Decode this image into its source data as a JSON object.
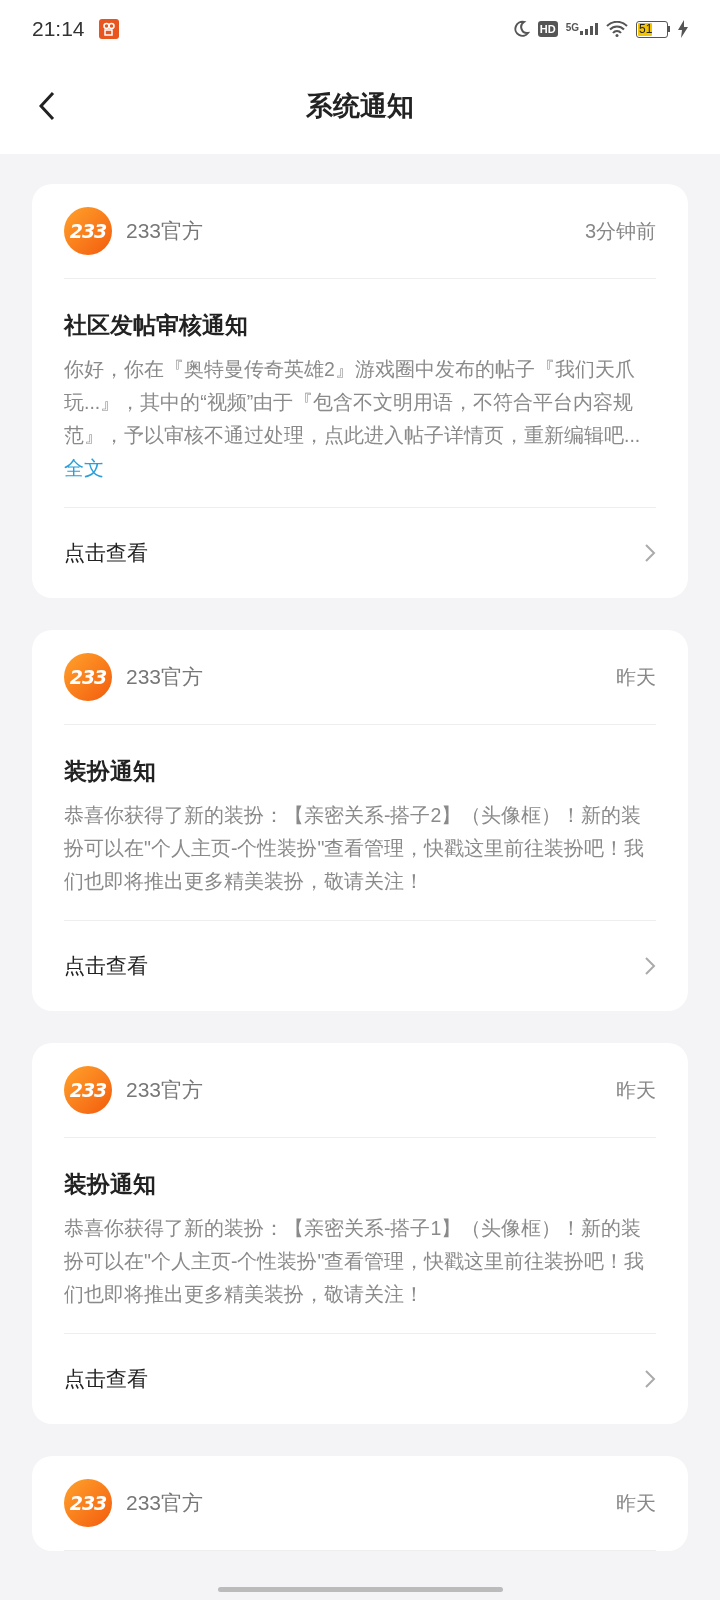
{
  "status_bar": {
    "time": "21:14",
    "network": "5G",
    "hd": "HD",
    "battery": "51"
  },
  "header": {
    "title": "系统通知"
  },
  "notifications": [
    {
      "logo_text": "233",
      "sender": "233官方",
      "time": "3分钟前",
      "title": "社区发帖审核通知",
      "body": "你好，你在『奥特曼传奇英雄2』游戏圈中发布的帖子『我们天爪玩...』，其中的“视频”由于『包含不文明用语，不符合平台内容规范』，予以审核不通过处理，点此进入帖子详情页，重新编辑吧...",
      "more_link": "全文",
      "action": "点击查看"
    },
    {
      "logo_text": "233",
      "sender": "233官方",
      "time": "昨天",
      "title": "装扮通知",
      "body": "恭喜你获得了新的装扮：【亲密关系-搭子2】（头像框）！新的装扮可以在\"个人主页-个性装扮\"查看管理，快戳这里前往装扮吧！我们也即将推出更多精美装扮，敬请关注！",
      "action": "点击查看"
    },
    {
      "logo_text": "233",
      "sender": "233官方",
      "time": "昨天",
      "title": "装扮通知",
      "body": "恭喜你获得了新的装扮：【亲密关系-搭子1】（头像框）！新的装扮可以在\"个人主页-个性装扮\"查看管理，快戳这里前往装扮吧！我们也即将推出更多精美装扮，敬请关注！",
      "action": "点击查看"
    },
    {
      "logo_text": "233",
      "sender": "233官方",
      "time": "昨天"
    }
  ]
}
